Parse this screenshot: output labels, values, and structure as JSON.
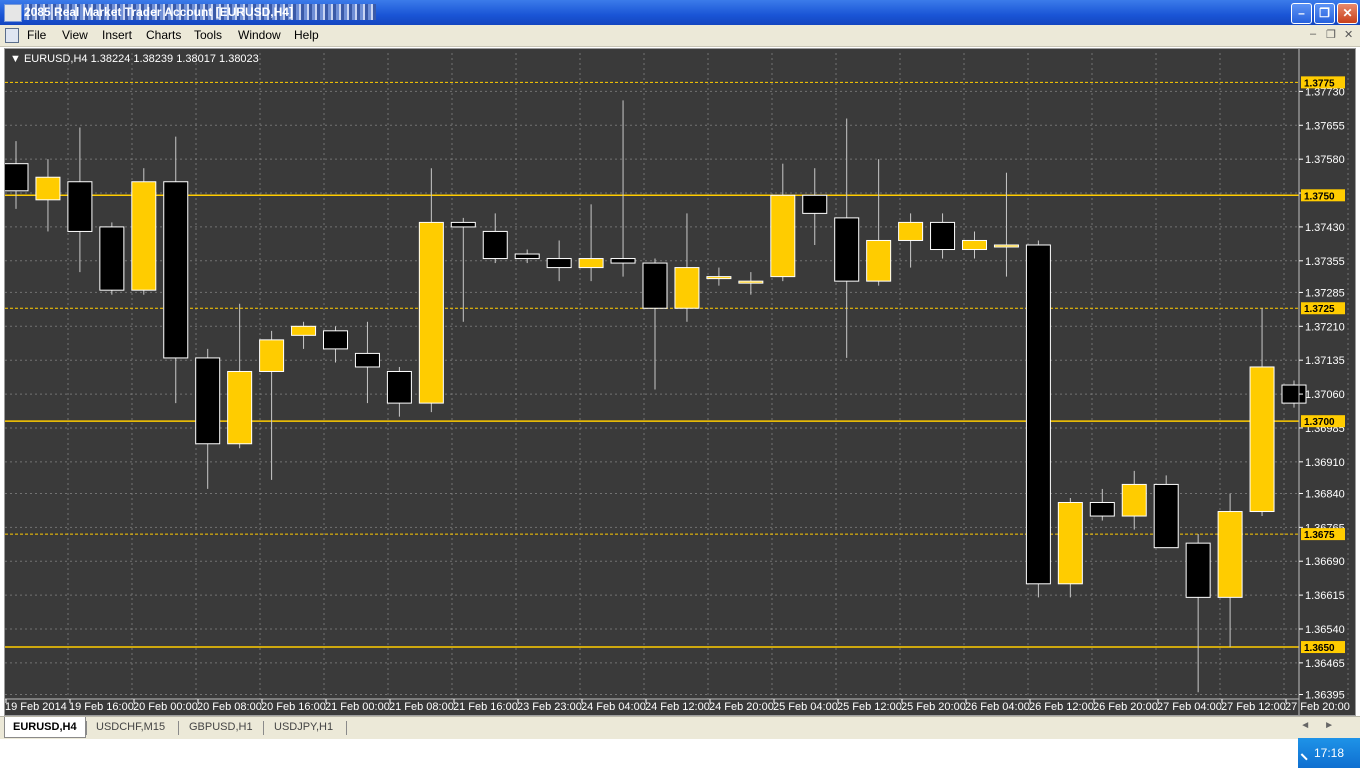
{
  "window": {
    "title": "2085 Real Market Trader Account [EURUSD,H4]",
    "buttons": {
      "minimize": "–",
      "restore": "❐",
      "close": "✕"
    }
  },
  "menu": {
    "items": [
      "File",
      "View",
      "Insert",
      "Charts",
      "Tools",
      "Window",
      "Help"
    ],
    "mdi": {
      "minimize": "–",
      "restore": "❐",
      "close": "✕"
    }
  },
  "chart": {
    "header": "▼ EURUSD,H4  1.38224 1.38239 1.38017 1.38023",
    "colors": {
      "background": "#3a3a3a",
      "grid": "#8a8a8a",
      "bull": "#ffcc00",
      "bear": "#000000",
      "wick": "#c8c8c8",
      "level_line": "#ffcc00",
      "price_label_bg": "#ffcc00"
    }
  },
  "chart_data": {
    "type": "candlestick",
    "symbol": "EURUSD",
    "timeframe": "H4",
    "ohlc_header": [
      1.38224,
      1.38239,
      1.38017,
      1.38023
    ],
    "y_ticks": [
      1.3773,
      1.37655,
      1.3758,
      1.37505,
      1.3743,
      1.37355,
      1.37285,
      1.3721,
      1.37135,
      1.3706,
      1.36985,
      1.3691,
      1.3684,
      1.36765,
      1.3669,
      1.36615,
      1.3654,
      1.36465,
      1.36395
    ],
    "y_tick_labels": [
      "1.37730",
      "1.37655",
      "1.37580",
      "1.37505",
      "1.37430",
      "1.37355",
      "1.37285",
      "1.37210",
      "1.37135",
      "1.37060",
      "1.36985",
      "1.36910",
      "1.36840",
      "1.36765",
      "1.36690",
      "1.36615",
      "1.36540",
      "1.36465",
      "1.36395"
    ],
    "ylim": [
      1.36385,
      1.37815
    ],
    "x_labels": [
      "19 Feb 2014",
      "19 Feb 16:00",
      "20 Feb 00:00",
      "20 Feb 08:00",
      "20 Feb 16:00",
      "21 Feb 00:00",
      "21 Feb 08:00",
      "21 Feb 16:00",
      "23 Feb 23:00",
      "24 Feb 04:00",
      "24 Feb 12:00",
      "24 Feb 20:00",
      "25 Feb 04:00",
      "25 Feb 12:00",
      "25 Feb 20:00",
      "26 Feb 04:00",
      "26 Feb 12:00",
      "26 Feb 20:00",
      "27 Feb 04:00",
      "27 Feb 12:00",
      "27 Feb 20:00"
    ],
    "levels": [
      {
        "price": 1.3775,
        "label": "1.3775",
        "style": "dashed"
      },
      {
        "price": 1.375,
        "label": "1.3750",
        "style": "solid"
      },
      {
        "price": 1.3725,
        "label": "1.3725",
        "style": "dashed"
      },
      {
        "price": 1.37,
        "label": "1.3700",
        "style": "solid"
      },
      {
        "price": 1.3675,
        "label": "1.3675",
        "style": "dashed"
      },
      {
        "price": 1.365,
        "label": "1.3650",
        "style": "solid"
      }
    ],
    "candles": [
      {
        "o": 1.3757,
        "h": 1.3762,
        "l": 1.3747,
        "c": 1.3751
      },
      {
        "o": 1.3749,
        "h": 1.3758,
        "l": 1.3742,
        "c": 1.3754
      },
      {
        "o": 1.3753,
        "h": 1.3765,
        "l": 1.3733,
        "c": 1.3742
      },
      {
        "o": 1.3743,
        "h": 1.3744,
        "l": 1.3728,
        "c": 1.3729
      },
      {
        "o": 1.3729,
        "h": 1.3756,
        "l": 1.3728,
        "c": 1.3753
      },
      {
        "o": 1.3753,
        "h": 1.3763,
        "l": 1.3704,
        "c": 1.3714
      },
      {
        "o": 1.3714,
        "h": 1.3716,
        "l": 1.3685,
        "c": 1.3695
      },
      {
        "o": 1.3695,
        "h": 1.3726,
        "l": 1.3694,
        "c": 1.3711
      },
      {
        "o": 1.3711,
        "h": 1.372,
        "l": 1.3687,
        "c": 1.3718
      },
      {
        "o": 1.3719,
        "h": 1.3722,
        "l": 1.3716,
        "c": 1.3721
      },
      {
        "o": 1.372,
        "h": 1.3721,
        "l": 1.3713,
        "c": 1.3716
      },
      {
        "o": 1.3715,
        "h": 1.3722,
        "l": 1.3704,
        "c": 1.3712
      },
      {
        "o": 1.3711,
        "h": 1.3712,
        "l": 1.3701,
        "c": 1.3704
      },
      {
        "o": 1.3704,
        "h": 1.3756,
        "l": 1.3702,
        "c": 1.3744
      },
      {
        "o": 1.3744,
        "h": 1.3745,
        "l": 1.3722,
        "c": 1.3743
      },
      {
        "o": 1.3742,
        "h": 1.3746,
        "l": 1.3735,
        "c": 1.3736
      },
      {
        "o": 1.3737,
        "h": 1.3738,
        "l": 1.3735,
        "c": 1.3736
      },
      {
        "o": 1.3736,
        "h": 1.374,
        "l": 1.3731,
        "c": 1.3734
      },
      {
        "o": 1.3734,
        "h": 1.3748,
        "l": 1.3731,
        "c": 1.3736
      },
      {
        "o": 1.3736,
        "h": 1.3771,
        "l": 1.3732,
        "c": 1.3735
      },
      {
        "o": 1.3735,
        "h": 1.3736,
        "l": 1.3707,
        "c": 1.3725
      },
      {
        "o": 1.3725,
        "h": 1.3746,
        "l": 1.3722,
        "c": 1.3734
      },
      {
        "o": 1.3732,
        "h": 1.3734,
        "l": 1.373,
        "c": 1.3732
      },
      {
        "o": 1.3731,
        "h": 1.3733,
        "l": 1.3728,
        "c": 1.3731
      },
      {
        "o": 1.3732,
        "h": 1.3757,
        "l": 1.3731,
        "c": 1.375
      },
      {
        "o": 1.375,
        "h": 1.3756,
        "l": 1.3739,
        "c": 1.3746
      },
      {
        "o": 1.3745,
        "h": 1.3767,
        "l": 1.3714,
        "c": 1.3731
      },
      {
        "o": 1.3731,
        "h": 1.3758,
        "l": 1.373,
        "c": 1.374
      },
      {
        "o": 1.374,
        "h": 1.3746,
        "l": 1.3734,
        "c": 1.3744
      },
      {
        "o": 1.3744,
        "h": 1.3746,
        "l": 1.3736,
        "c": 1.3738
      },
      {
        "o": 1.3738,
        "h": 1.3742,
        "l": 1.3736,
        "c": 1.374
      },
      {
        "o": 1.3739,
        "h": 1.3755,
        "l": 1.3732,
        "c": 1.3739
      },
      {
        "o": 1.3739,
        "h": 1.374,
        "l": 1.3661,
        "c": 1.3664
      },
      {
        "o": 1.3664,
        "h": 1.3683,
        "l": 1.3661,
        "c": 1.3682
      },
      {
        "o": 1.3682,
        "h": 1.3685,
        "l": 1.3678,
        "c": 1.3679
      },
      {
        "o": 1.3679,
        "h": 1.3689,
        "l": 1.3676,
        "c": 1.3686
      },
      {
        "o": 1.3686,
        "h": 1.3688,
        "l": 1.3672,
        "c": 1.3672
      },
      {
        "o": 1.3673,
        "h": 1.3675,
        "l": 1.364,
        "c": 1.3661
      },
      {
        "o": 1.3661,
        "h": 1.3684,
        "l": 1.365,
        "c": 1.368
      },
      {
        "o": 1.368,
        "h": 1.3725,
        "l": 1.3679,
        "c": 1.3712
      },
      {
        "o": 1.3708,
        "h": 1.3709,
        "l": 1.3703,
        "c": 1.3704
      }
    ],
    "x_first": 11,
    "x_step": 31.95
  },
  "tabs": [
    "EURUSD,H4",
    "USDCHF,M15",
    "GBPUSD,H1",
    "USDJPY,H1"
  ],
  "tab_nav": [
    "◄",
    "►"
  ],
  "clock": "17:18"
}
